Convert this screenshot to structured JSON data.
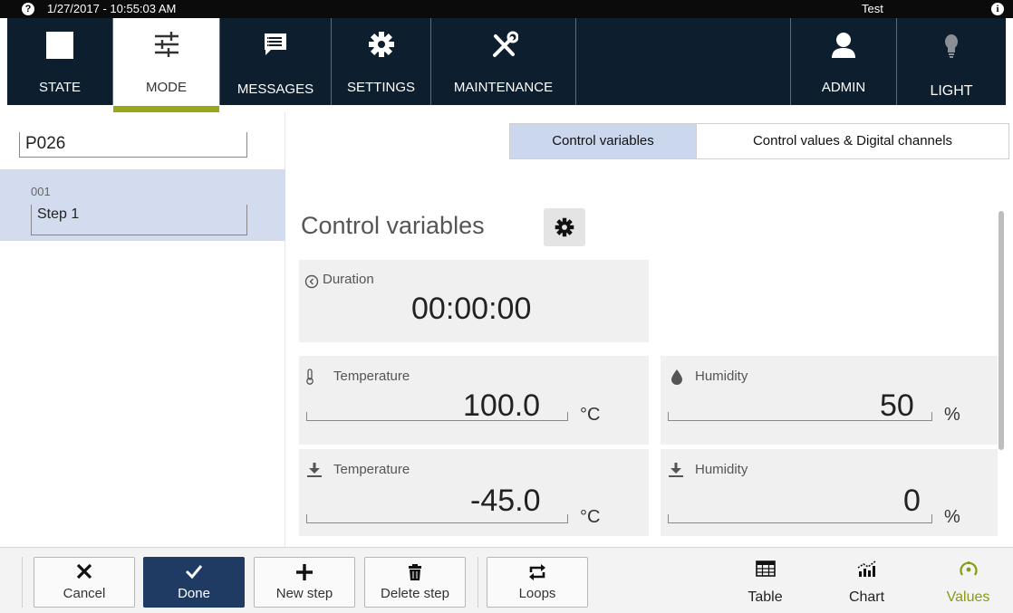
{
  "status_bar": {
    "datetime": "1/27/2017 - 10:55:03 AM",
    "user": "Test",
    "help_glyph": "?",
    "info_glyph": "i"
  },
  "nav": {
    "items": [
      {
        "label": "STATE",
        "icon": "stop-square-icon"
      },
      {
        "label": "MODE",
        "icon": "sliders-icon",
        "active": true
      },
      {
        "label": "MESSAGES",
        "icon": "message-icon"
      },
      {
        "label": "SETTINGS",
        "icon": "gear-icon"
      },
      {
        "label": "MAINTENANCE",
        "icon": "tools-icon"
      }
    ],
    "right_items": [
      {
        "label": "ADMIN",
        "icon": "user-icon"
      },
      {
        "label": "LIGHT",
        "icon": "bulb-icon"
      }
    ],
    "accent": "#99a71a"
  },
  "program": {
    "name": "P026",
    "steps": [
      {
        "number": "001",
        "name": "Step 1"
      }
    ]
  },
  "tabs": [
    {
      "label": "Control variables",
      "active": true
    },
    {
      "label": "Control values & Digital channels",
      "active": false
    }
  ],
  "section": {
    "title": "Control variables"
  },
  "fields": {
    "duration": {
      "label": "Duration",
      "value": "00:00:00"
    },
    "temp_high": {
      "label": "Temperature",
      "value": "100.0",
      "unit": "°C"
    },
    "humidity_high": {
      "label": "Humidity",
      "value": "50",
      "unit": "%"
    },
    "temp_low": {
      "label": "Temperature",
      "value": "-45.0",
      "unit": "°C"
    },
    "humidity_low": {
      "label": "Humidity",
      "value": "0",
      "unit": "%"
    }
  },
  "toolbar": {
    "cancel": "Cancel",
    "done": "Done",
    "new_step": "New step",
    "delete_step": "Delete step",
    "loops": "Loops",
    "table": "Table",
    "chart": "Chart",
    "values": "Values"
  },
  "colors": {
    "nav_bg": "#0d1e2e",
    "selected_row": "#d2dcee",
    "done_button": "#1f3b64",
    "values_active": "#8a9a11"
  }
}
